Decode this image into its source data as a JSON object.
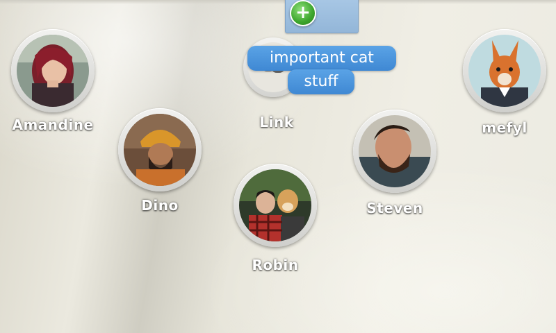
{
  "add_button": {
    "symbol": "+"
  },
  "link_item": {
    "name": "Link",
    "note_lines": [
      "important cat",
      "stuff"
    ],
    "icon": "link-icon"
  },
  "contacts": [
    {
      "name": "Amandine"
    },
    {
      "name": "Dino"
    },
    {
      "name": "Robin"
    },
    {
      "name": "Steven"
    },
    {
      "name": "mefyl"
    }
  ],
  "colors": {
    "bubble": "#4a94dc",
    "add_badge": "#3ca52c",
    "folder": "#9fbfe0"
  }
}
